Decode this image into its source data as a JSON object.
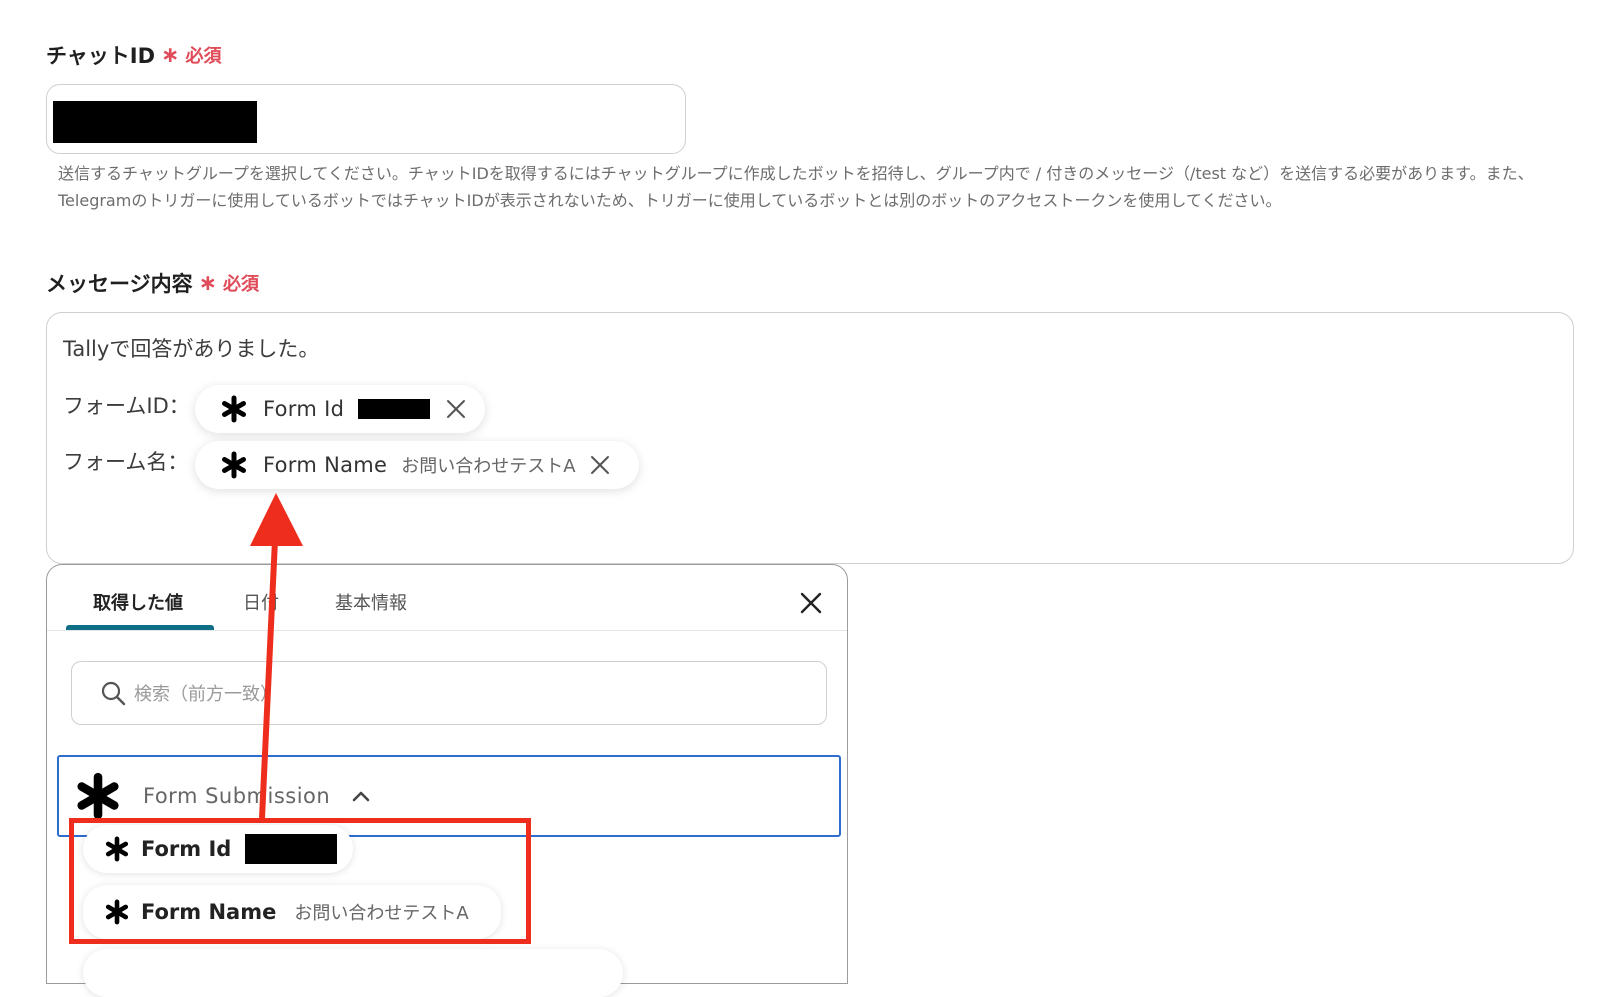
{
  "chat_id_field": {
    "label": "チャットID",
    "required_star": "∗",
    "required_text": "必須",
    "help_text": "送信するチャットグループを選択してください。チャットIDを取得するにはチャットグループに作成したボットを招待し、グループ内で / 付きのメッセージ（/test など）を送信する必要があります。また、Telegramのトリガーに使用しているボットではチャットIDが表示されないため、トリガーに使用しているボットとは別のボットのアクセストークンを使用してください。"
  },
  "message_field": {
    "label": "メッセージ内容",
    "required_star": "∗",
    "required_text": "必須",
    "line1": "Tallyで回答がありました。",
    "line2_label": "フォームID：",
    "line3_label": "フォーム名：",
    "chip_form_id": {
      "name": "Form Id",
      "icon": "tally-asterisk-icon"
    },
    "chip_form_name": {
      "name": "Form Name",
      "value": "お問い合わせテストA",
      "icon": "tally-asterisk-icon"
    }
  },
  "picker": {
    "tabs": [
      "取得した値",
      "日付",
      "基本情報"
    ],
    "active_tab": 0,
    "search_placeholder": "検索（前方一致）",
    "group": {
      "label": "Form Submission",
      "expanded": true
    },
    "items": [
      {
        "name": "Form Id",
        "value": ""
      },
      {
        "name": "Form Name",
        "value": "お問い合わせテストA"
      }
    ]
  },
  "colors": {
    "required": "#e04b59",
    "active_tab_underline": "#0f6f86",
    "group_border": "#2f6cd0",
    "annotation_red": "#ef2d1c"
  }
}
